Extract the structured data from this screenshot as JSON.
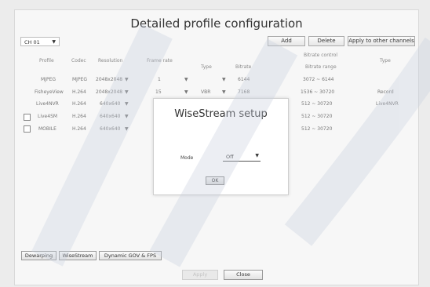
{
  "title": "Detailed profile configuration",
  "channel_select": {
    "value": "CH 01"
  },
  "toolbar": {
    "add": "Add",
    "delete": "Delete",
    "apply": "Apply to other channels"
  },
  "table": {
    "headers": {
      "profile": "Profile",
      "codec": "Codec",
      "resolution": "Resolution",
      "frame_rate": "Frame rate",
      "type": "Type",
      "bitrate": "Bitrate",
      "bitrate_control": "Bitrate control",
      "bitrate_range": "Bitrate range",
      "type2": "Type"
    },
    "rows": [
      {
        "profile": "MJPEG",
        "codec": "MJPEG",
        "resolution": "2048x2048",
        "frame": "1",
        "type": "",
        "bitrate": "6144",
        "range": "3072 ~ 6144",
        "tag": ""
      },
      {
        "profile": "FisheyeView",
        "codec": "H.264",
        "resolution": "2048x2048",
        "frame": "15",
        "type": "VBR",
        "bitrate": "7168",
        "range": "1536 ~ 30720",
        "tag": "Record"
      },
      {
        "profile": "Live4NVR",
        "codec": "H.264",
        "resolution": "640x640",
        "frame": "",
        "type": "",
        "bitrate": "",
        "range": "512 ~ 30720",
        "tag": "Live4NVR"
      },
      {
        "profile": "Live4SM",
        "codec": "H.264",
        "resolution": "640x640",
        "frame": "",
        "type": "",
        "bitrate": "",
        "range": "512 ~ 30720",
        "tag": ""
      },
      {
        "profile": "MOBILE",
        "codec": "H.264",
        "resolution": "640x640",
        "frame": "",
        "type": "",
        "bitrate": "",
        "range": "512 ~ 30720",
        "tag": ""
      }
    ]
  },
  "modal": {
    "title": "WiseStream setup",
    "mode_label": "Mode",
    "mode_value": "Off",
    "ok": "OK"
  },
  "bottom_buttons": {
    "dewarping": "Dewarping",
    "wisestream": "WiseStream",
    "dynamic_gov": "Dynamic GOV & FPS"
  },
  "footer": {
    "apply": "Apply",
    "close": "Close"
  }
}
